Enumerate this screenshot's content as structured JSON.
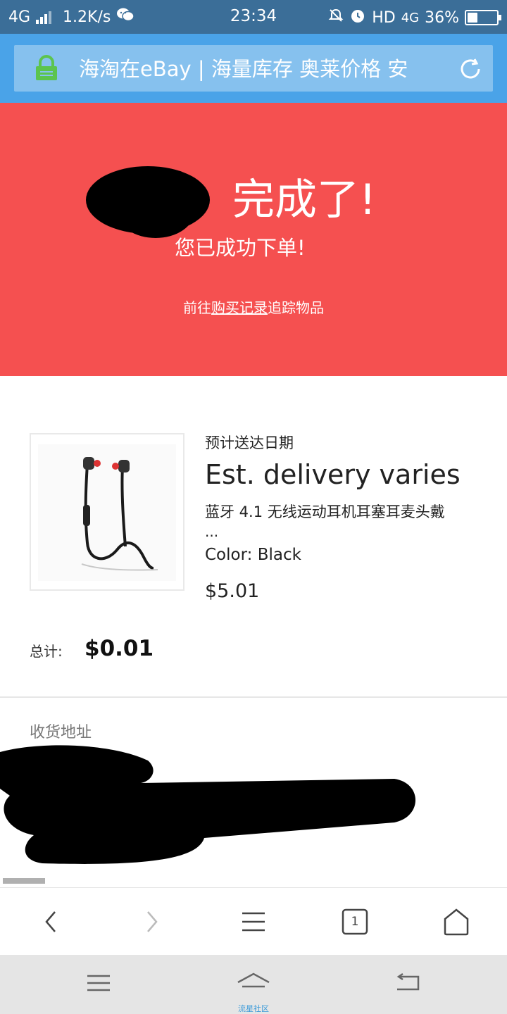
{
  "status_bar": {
    "network": "4G",
    "speed": "1.2K/s",
    "time": "23:34",
    "hd": "HD",
    "network2": "4G",
    "battery_text": "36%",
    "battery_level": 0.36
  },
  "url_bar": {
    "title": "海淘在eBay | 海量库存 奥莱价格 安"
  },
  "confirmation": {
    "title": "完成了!",
    "subtitle": "您已成功下单!",
    "link_prefix": "前往",
    "link_text": "购买记录",
    "link_suffix": "追踪物品"
  },
  "order": {
    "delivery_label": "预计送达日期",
    "delivery_value": "Est. delivery varies",
    "item_title": "蓝牙 4.1 无线运动耳机耳塞耳麦头戴",
    "item_title_more": "...",
    "item_color": "Color: Black",
    "item_price": "$5.01",
    "total_label": "总计:",
    "total_value": "$0.01"
  },
  "shipping": {
    "label": "收货地址"
  },
  "bottom_bar": {
    "tab_count": "1",
    "home_caption": "流星社区"
  },
  "colors": {
    "status_bar": "#3b6e98",
    "url_area": "#4aa3e8",
    "url_bar": "#86c1ee",
    "hero": "#f55050",
    "lock": "#5cc44e",
    "home_caption": "#3a9ad9"
  }
}
